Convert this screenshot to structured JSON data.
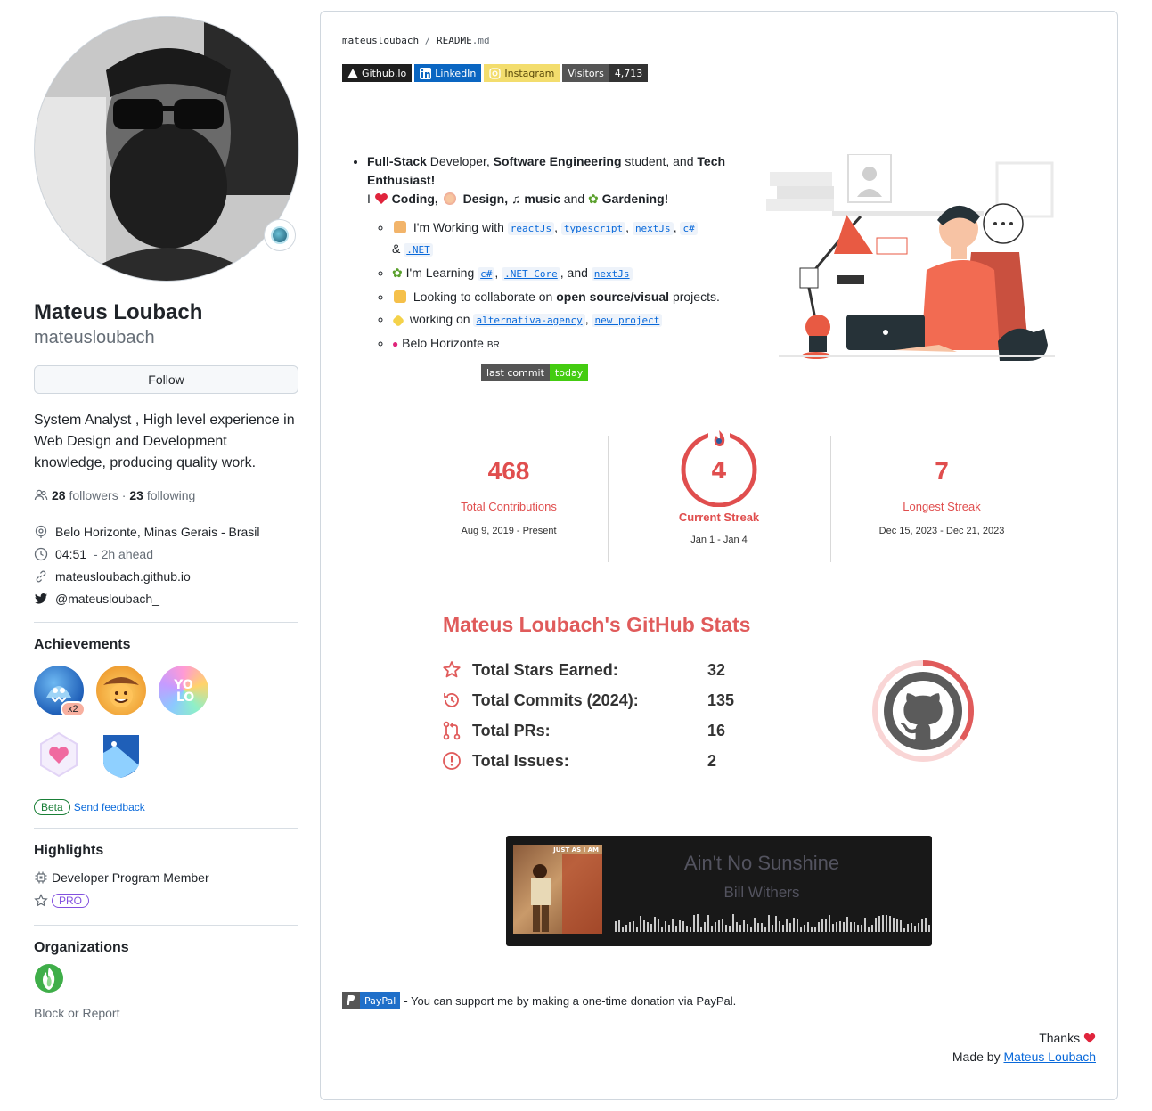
{
  "profile": {
    "name": "Mateus Loubach",
    "login": "mateusloubach",
    "follow_label": "Follow",
    "bio": "System Analyst , High level experience in Web Design and Development knowledge, producing quality work.",
    "followers_count": "28",
    "followers_label": "followers",
    "dot": "·",
    "following_count": "23",
    "following_label": "following",
    "location": "Belo Horizonte, Minas Gerais - Brasil",
    "time": "04:51",
    "time_offset": "- 2h ahead",
    "website": "mateusloubach.github.io",
    "twitter": "@mateusloubach_"
  },
  "achievements": {
    "title": "Achievements",
    "items": [
      {
        "icon": "shark-achievement-icon",
        "count": "x2"
      },
      {
        "icon": "cowboy-achievement-icon"
      },
      {
        "icon": "yolo-achievement-icon"
      },
      {
        "icon": "heart-achievement-icon"
      },
      {
        "icon": "arctic-code-vault-icon"
      }
    ],
    "beta_label": "Beta",
    "feedback_label": "Send feedback"
  },
  "highlights": {
    "title": "Highlights",
    "developer_program": "Developer Program Member",
    "pro_label": "PRO"
  },
  "organizations": {
    "title": "Organizations",
    "block_label": "Block or Report"
  },
  "readme": {
    "owner": "mateusloubach",
    "slash": "/",
    "file": "README",
    "ext": ".md",
    "shields": {
      "github": "Github.Io",
      "linkedin": "LinkedIn",
      "instagram": "Instagram",
      "visitors_label": "Visitors",
      "visitors_count": "4,713"
    },
    "intro": {
      "full_stack": "Full-Stack",
      "developer": " Developer, ",
      "software_eng": "Software Engineering",
      "student_and": " student, and ",
      "tech": "Tech Enthusiast!",
      "i_label": "I",
      "coding": "Coding,",
      "design": "Design,",
      "music": "music",
      "and": "and",
      "gardening": "Gardening!",
      "working_with": "I'm Working with",
      "learning": "I'm Learning",
      "amp": "&",
      "comma": ",",
      "and2": ", and",
      "collab_pre": "Looking to collaborate on ",
      "collab_bold": "open source/visual",
      "collab_post": " projects.",
      "working_on": "working on",
      "location": "Belo Horizonte",
      "location_code": "BR",
      "tags_working": [
        "reactJs",
        "typescript",
        "nextJs",
        "c#",
        ".NET"
      ],
      "tags_learning": [
        "c#",
        ".NET Core",
        "nextJs"
      ],
      "tags_projects": [
        "alternativa-agency",
        "new project"
      ]
    },
    "last_commit_label": "last commit",
    "last_commit_value": "today"
  },
  "streak": {
    "total_value": "468",
    "total_label": "Total Contributions",
    "total_range": "Aug 9, 2019 - Present",
    "current_value": "4",
    "current_label": "Current Streak",
    "current_range": "Jan 1 - Jan 4",
    "longest_value": "7",
    "longest_label": "Longest Streak",
    "longest_range": "Dec 15, 2023 - Dec 21, 2023"
  },
  "stats": {
    "title": "Mateus Loubach's GitHub Stats",
    "rows": [
      {
        "label": "Total Stars Earned:",
        "value": "32",
        "icon": "star-icon"
      },
      {
        "label": "Total Commits (2024):",
        "value": "135",
        "icon": "history-icon"
      },
      {
        "label": "Total PRs:",
        "value": "16",
        "icon": "pull-request-icon"
      },
      {
        "label": "Total Issues:",
        "value": "2",
        "icon": "issue-icon"
      }
    ],
    "ring_fraction": 0.35
  },
  "music": {
    "song": "Ain't No Sunshine",
    "artist": "Bill Withers",
    "cover_text": "JUST AS I AM"
  },
  "paypal": {
    "label": "PayPal",
    "text": "- You can support me by making a one-time donation via PayPal."
  },
  "footer": {
    "thanks": "Thanks",
    "made_by": "Made by",
    "author": "Mateus Loubach"
  },
  "colors": {
    "accent": "#e05b5b",
    "link": "#0969da",
    "muted": "#656d76"
  }
}
